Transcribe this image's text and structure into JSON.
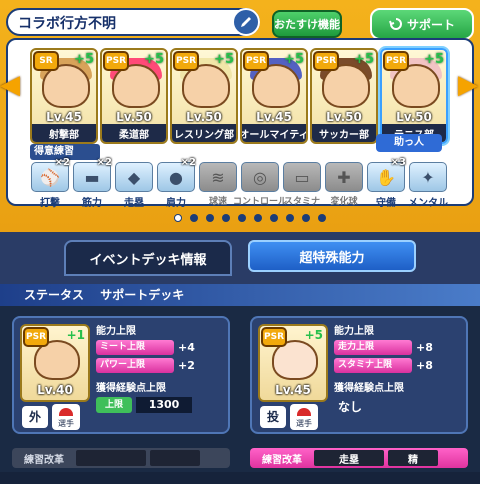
{
  "header": {
    "title": "コラボ行方不明",
    "recommend_label": "おたすけ機能",
    "support_tab_label": "サポート"
  },
  "deck": {
    "cards": [
      {
        "rarity": "SR",
        "bonus": "+5",
        "level": "Lv.45",
        "team": "射撃部",
        "hair_color": "#d8a35a"
      },
      {
        "rarity": "PSR",
        "bonus": "+5",
        "level": "Lv.50",
        "team": "柔道部",
        "hair_color": "#ff4a78"
      },
      {
        "rarity": "PSR",
        "bonus": "+5",
        "level": "Lv.50",
        "team": "レスリング部",
        "hair_color": "#f1e6a8"
      },
      {
        "rarity": "PSR",
        "bonus": "+5",
        "level": "Lv.45",
        "team": "オールマイティ",
        "hair_color": "#5461c2"
      },
      {
        "rarity": "PSR",
        "bonus": "+5",
        "level": "Lv.50",
        "team": "サッカー部",
        "hair_color": "#7a4b2a"
      },
      {
        "rarity": "PSR",
        "bonus": "+5",
        "level": "Lv.50",
        "team": "テニス部",
        "hair_color": "#f2c4c4"
      }
    ],
    "helper_badge": "助っ人",
    "practice_section_label": "得意練習",
    "practices": [
      {
        "name": "打撃",
        "icon": "bat-icon",
        "symbol": "⚾",
        "mult": "×2",
        "active": true
      },
      {
        "name": "筋力",
        "icon": "dumbbell-icon",
        "symbol": "▬",
        "mult": "×2",
        "active": true
      },
      {
        "name": "走塁",
        "icon": "base-icon",
        "symbol": "◆",
        "mult": "",
        "active": true
      },
      {
        "name": "肩力",
        "icon": "ball-icon",
        "symbol": "●",
        "mult": "×2",
        "active": true
      },
      {
        "name": "球速",
        "icon": "speed-icon",
        "symbol": "≋",
        "mult": "",
        "active": false
      },
      {
        "name": "コントロール",
        "icon": "target-icon",
        "symbol": "◎",
        "mult": "",
        "active": false
      },
      {
        "name": "スタミナ",
        "icon": "stamina-icon",
        "symbol": "▭",
        "mult": "",
        "active": false
      },
      {
        "name": "変化球",
        "icon": "breaking-ball-icon",
        "symbol": "✚",
        "mult": "",
        "active": false
      },
      {
        "name": "守備",
        "icon": "glove-icon",
        "symbol": "✋",
        "mult": "×3",
        "active": true
      },
      {
        "name": "メンタル",
        "icon": "mental-icon",
        "symbol": "✦",
        "mult": "",
        "active": true
      }
    ]
  },
  "pagination": {
    "count": 10,
    "active_index": 0
  },
  "tabs": {
    "event_deck_label": "イベントデッキ情報",
    "special_ability_label": "超特殊能力"
  },
  "status_header": {
    "status_label": "ステータス",
    "support_deck_label": "サポートデッキ"
  },
  "support_cards": [
    {
      "rarity": "PSR",
      "bonus": "+1",
      "level": "Lv.40",
      "position": "外",
      "position_sub": "選手",
      "ability_label": "能力上限",
      "stats": [
        {
          "name": "ミート上限",
          "value": "+4"
        },
        {
          "name": "パワー上限",
          "value": "+2"
        }
      ],
      "exp_label": "獲得経験点上限",
      "exp_limit_label": "上限",
      "exp_limit_value": "1300",
      "exp_none": "",
      "practice_bar": {
        "label": "練習改革",
        "slot1": "",
        "slot2": "",
        "style": "gray"
      }
    },
    {
      "rarity": "PSR",
      "bonus": "+5",
      "level": "Lv.45",
      "position": "投",
      "position_sub": "選手",
      "ability_label": "能力上限",
      "stats": [
        {
          "name": "走力上限",
          "value": "+8"
        },
        {
          "name": "スタミナ上限",
          "value": "+8"
        }
      ],
      "exp_label": "獲得経験点上限",
      "exp_limit_label": "",
      "exp_limit_value": "",
      "exp_none": "なし",
      "practice_bar": {
        "label": "練習改革",
        "slot1": "走塁",
        "slot2": "精",
        "style": "pink"
      }
    }
  ]
}
